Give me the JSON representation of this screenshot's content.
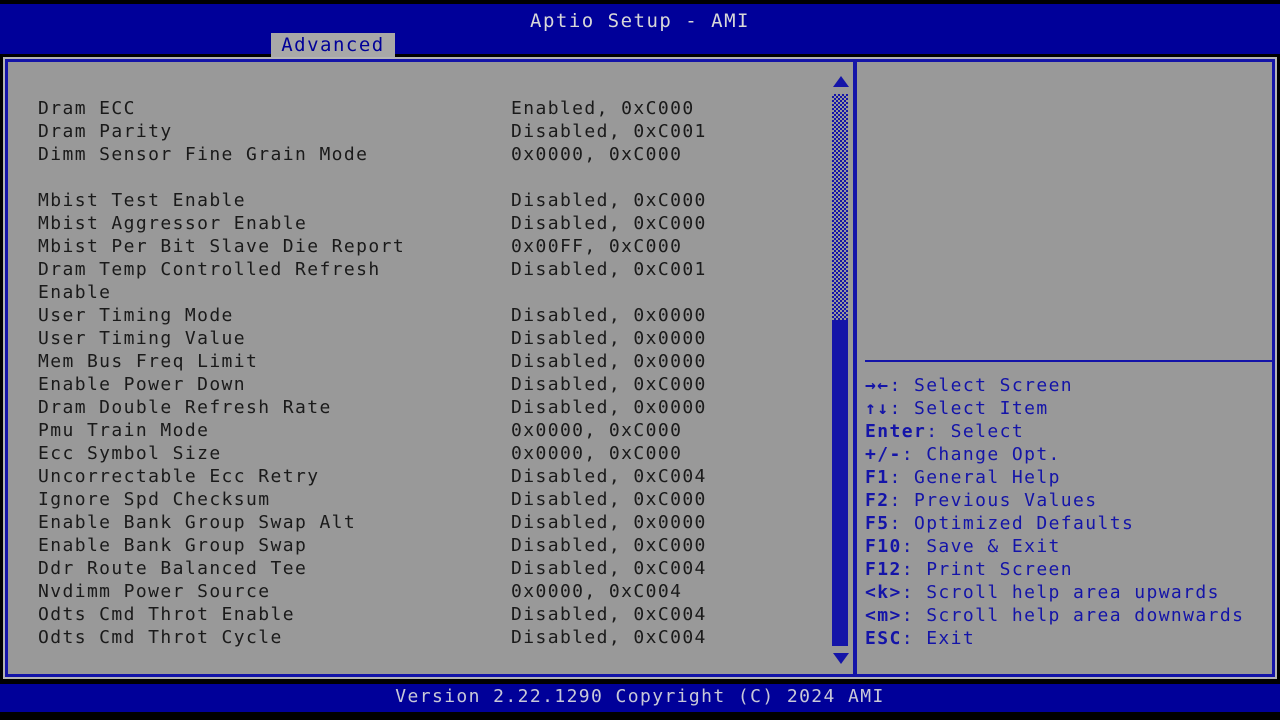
{
  "header": {
    "title": "Aptio Setup - AMI",
    "tabs": [
      {
        "label": "Advanced",
        "active": true
      }
    ]
  },
  "colors": {
    "header_blue": "#000099",
    "panel_gray": "#999999",
    "frame_blue": "#1414a8",
    "text_dark": "#1a1a1a",
    "help_text": "#1414a8",
    "tab_bg": "#a8a8a8",
    "tab_text": "#000099"
  },
  "settings": {
    "rows": [
      {
        "label": "Dram ECC",
        "value": "Enabled, 0xC000"
      },
      {
        "label": "Dram Parity",
        "value": "Disabled, 0xC001"
      },
      {
        "label": "Dimm Sensor Fine Grain Mode",
        "value": "0x0000, 0xC000"
      },
      {
        "label": "",
        "value": ""
      },
      {
        "label": "Mbist Test Enable",
        "value": "Disabled, 0xC000"
      },
      {
        "label": "Mbist Aggressor Enable",
        "value": "Disabled, 0xC000"
      },
      {
        "label": "Mbist Per Bit Slave Die Report",
        "value": "0x00FF, 0xC000"
      },
      {
        "label": "Dram Temp Controlled Refresh",
        "value": "Disabled, 0xC001"
      },
      {
        "label": "Enable",
        "value": ""
      },
      {
        "label": "User Timing Mode",
        "value": "Disabled, 0x0000"
      },
      {
        "label": "User Timing Value",
        "value": "Disabled, 0x0000"
      },
      {
        "label": "Mem Bus Freq Limit",
        "value": "Disabled, 0x0000"
      },
      {
        "label": "Enable Power Down",
        "value": "Disabled, 0xC000"
      },
      {
        "label": "Dram Double Refresh Rate",
        "value": "Disabled, 0x0000"
      },
      {
        "label": "Pmu Train Mode",
        "value": "0x0000, 0xC000"
      },
      {
        "label": "Ecc Symbol Size",
        "value": "0x0000, 0xC000"
      },
      {
        "label": "Uncorrectable Ecc Retry",
        "value": "Disabled, 0xC004"
      },
      {
        "label": "Ignore Spd Checksum",
        "value": "Disabled, 0xC000"
      },
      {
        "label": "Enable Bank Group Swap Alt",
        "value": "Disabled, 0x0000"
      },
      {
        "label": "Enable Bank Group Swap",
        "value": "Disabled, 0xC000"
      },
      {
        "label": "Ddr Route Balanced Tee",
        "value": "Disabled, 0xC004"
      },
      {
        "label": "Nvdimm Power Source",
        "value": "0x0000, 0xC004"
      },
      {
        "label": "Odts Cmd Throt Enable",
        "value": "Disabled, 0xC004"
      },
      {
        "label": "Odts Cmd Throt Cycle",
        "value": "Disabled, 0xC004"
      }
    ]
  },
  "scrollbar": {
    "up_arrow": "scroll-up-arrow",
    "down_arrow": "scroll-down-arrow"
  },
  "help": {
    "rows": [
      {
        "key": "→←",
        "text": ": Select Screen"
      },
      {
        "key": "↑↓",
        "text": ": Select Item"
      },
      {
        "key": "Enter",
        "text": ": Select"
      },
      {
        "key": "+/-",
        "text": ": Change Opt."
      },
      {
        "key": "F1",
        "text": ": General Help"
      },
      {
        "key": "F2",
        "text": ": Previous Values"
      },
      {
        "key": "F5",
        "text": ": Optimized Defaults"
      },
      {
        "key": "F10",
        "text": ": Save & Exit"
      },
      {
        "key": "F12",
        "text": ": Print Screen"
      },
      {
        "key": "<k>",
        "text": ": Scroll help area upwards"
      },
      {
        "key": "<m>",
        "text": ": Scroll help area downwards"
      },
      {
        "key": "ESC",
        "text": ": Exit"
      }
    ]
  },
  "footer": {
    "version_text": "Version 2.22.1290 Copyright (C) 2024 AMI"
  }
}
